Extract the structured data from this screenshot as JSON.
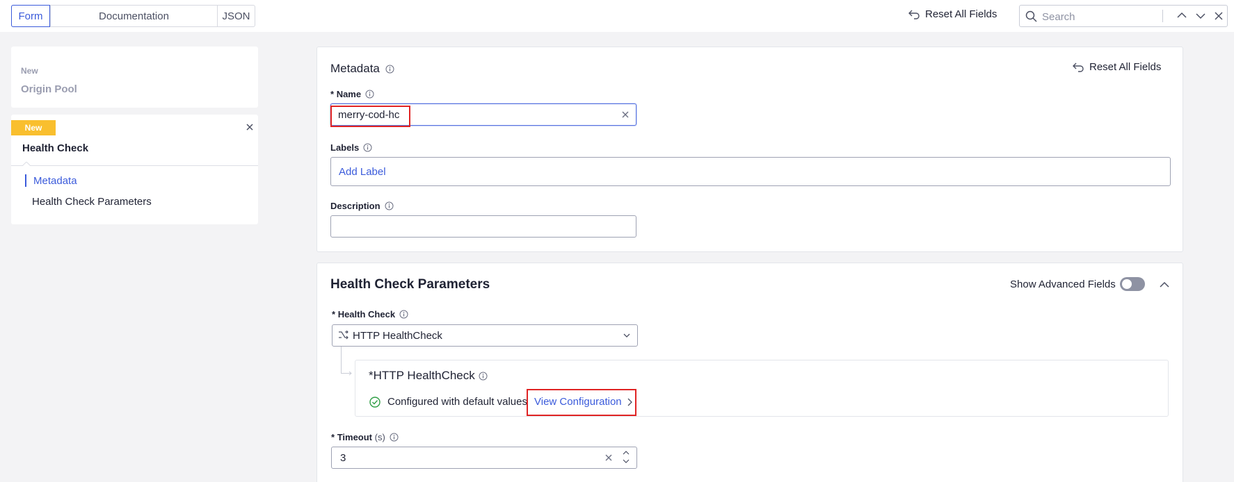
{
  "topbar": {
    "tabs": [
      {
        "label": "Form",
        "active": true
      },
      {
        "label": "Documentation",
        "active": false
      },
      {
        "label": "JSON",
        "active": false
      }
    ],
    "reset_label": "Reset All Fields",
    "search": {
      "placeholder": "Search"
    }
  },
  "sidebar": {
    "origin_pool": {
      "badge": "New",
      "title": "Origin Pool"
    },
    "health_check": {
      "badge": "New",
      "title": "Health Check",
      "nav": [
        {
          "label": "Metadata",
          "active": true
        },
        {
          "label": "Health Check Parameters",
          "active": false
        }
      ]
    }
  },
  "metadata": {
    "title": "Metadata",
    "reset_label": "Reset All Fields",
    "name": {
      "label": "Name",
      "required": "*",
      "value": "merry-cod-hc"
    },
    "labels": {
      "label": "Labels",
      "add_label": "Add Label"
    },
    "description": {
      "label": "Description",
      "value": ""
    }
  },
  "health_check_params": {
    "title": "Health Check Parameters",
    "advanced_label": "Show Advanced Fields",
    "advanced_on": false,
    "health_check": {
      "label": "Health Check",
      "required": "*",
      "value": "HTTP HealthCheck"
    },
    "http": {
      "required": "*",
      "title": "HTTP HealthCheck",
      "status": "Configured with default values",
      "view_config": "View Configuration"
    },
    "timeout": {
      "label": "Timeout",
      "unit": "(s)",
      "required": "*",
      "value": "3"
    }
  },
  "colors": {
    "accent": "#3b5bdb",
    "badge": "#f9bf2e",
    "highlight": "#e02424",
    "success": "#2f9e44"
  }
}
